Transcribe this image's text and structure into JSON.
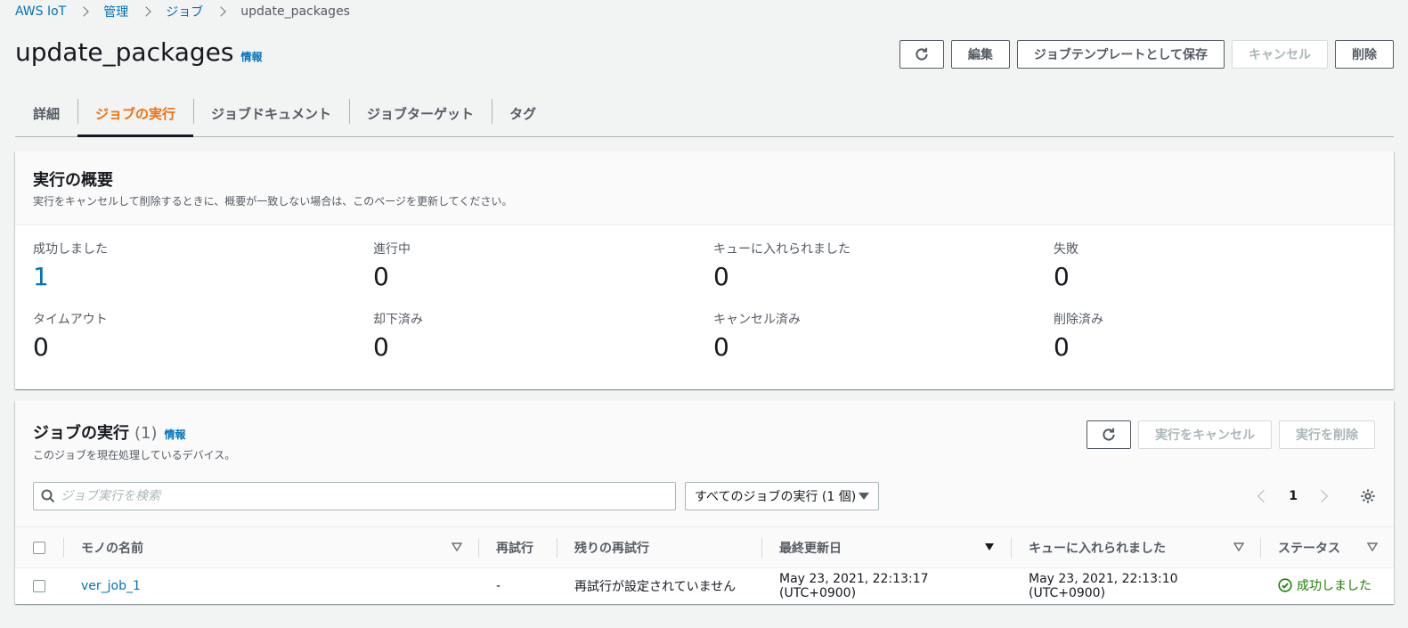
{
  "breadcrumb": [
    "AWS IoT",
    "管理",
    "ジョブ",
    "update_packages"
  ],
  "header": {
    "title": "update_packages",
    "info": "情報",
    "buttons": {
      "edit": "編集",
      "save_template": "ジョブテンプレートとして保存",
      "cancel": "キャンセル",
      "delete": "削除"
    }
  },
  "tabs": [
    "詳細",
    "ジョブの実行",
    "ジョブドキュメント",
    "ジョブターゲット",
    "タグ"
  ],
  "active_tab": "ジョブの実行",
  "summary": {
    "title": "実行の概要",
    "description": "実行をキャンセルして削除するときに、概要が一致しない場合は、このページを更新してください。",
    "stats": [
      {
        "label": "成功しました",
        "value": "1"
      },
      {
        "label": "進行中",
        "value": "0"
      },
      {
        "label": "キューに入れられました",
        "value": "0"
      },
      {
        "label": "失敗",
        "value": "0"
      },
      {
        "label": "タイムアウト",
        "value": "0"
      },
      {
        "label": "却下済み",
        "value": "0"
      },
      {
        "label": "キャンセル済み",
        "value": "0"
      },
      {
        "label": "削除済み",
        "value": "0"
      }
    ]
  },
  "executions": {
    "title": "ジョブの実行",
    "count": "(1)",
    "info": "情報",
    "description": "このジョブを現在処理しているデバイス。",
    "buttons": {
      "cancel_exec": "実行をキャンセル",
      "delete_exec": "実行を削除"
    },
    "search_placeholder": "ジョブ実行を検索",
    "filter_selected": "すべてのジョブの実行 (1 個)",
    "page": "1",
    "columns": {
      "thing_name": "モノの名前",
      "retry": "再試行",
      "remaining_retry": "残りの再試行",
      "last_updated": "最終更新日",
      "queued": "キューに入れられました",
      "status": "ステータス"
    },
    "rows": [
      {
        "thing_name": "ver_job_1",
        "retry": "-",
        "remaining_retry": "再試行が設定されていません",
        "last_updated": "May 23, 2021, 22:13:17 (UTC+0900)",
        "queued": "May 23, 2021, 22:13:10 (UTC+0900)",
        "status": "成功しました"
      }
    ]
  },
  "colors": {
    "accent": "#ec7211",
    "link": "#0073bb",
    "success": "#1d8102"
  }
}
